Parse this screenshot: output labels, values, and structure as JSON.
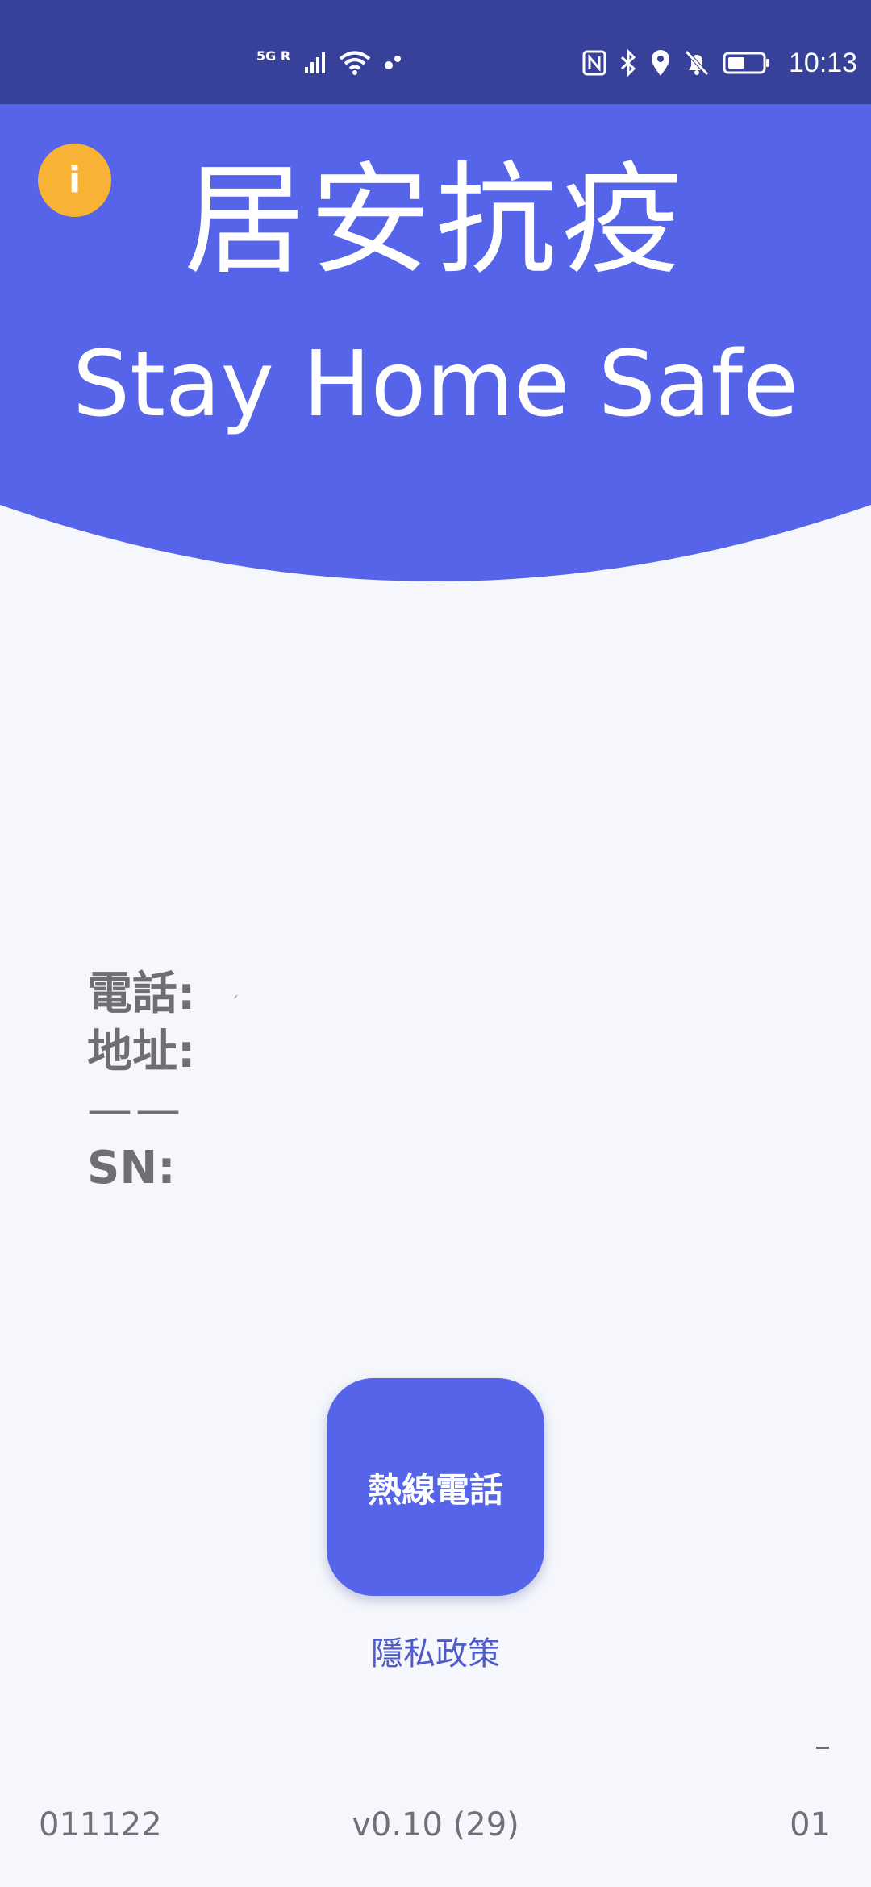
{
  "status_bar": {
    "time": "10:13",
    "network_label": "5G R",
    "icons": [
      "signal-icon",
      "wifi-icon",
      "dots-icon",
      "nfc-icon",
      "bluetooth-icon",
      "location-icon",
      "bell-off-icon",
      "battery-icon"
    ],
    "background_color": "#384199"
  },
  "header": {
    "title_zh": "居安抗疫",
    "title_en": "Stay Home Safe",
    "background_color": "#5564e8",
    "info_button_icon": "info-icon",
    "info_button_glyph": "i",
    "info_button_color": "#f8b334"
  },
  "details": {
    "phone_label": "電話:",
    "phone_value": "",
    "address_label": "地址:",
    "address_value": "",
    "separator": "——",
    "sn_label": "SN:",
    "sn_value": ""
  },
  "actions": {
    "hotline_label": "熱線電話",
    "privacy_label": "隱私政策"
  },
  "footer": {
    "left": "011122",
    "center": "v0.10 (29)",
    "right": "01"
  }
}
